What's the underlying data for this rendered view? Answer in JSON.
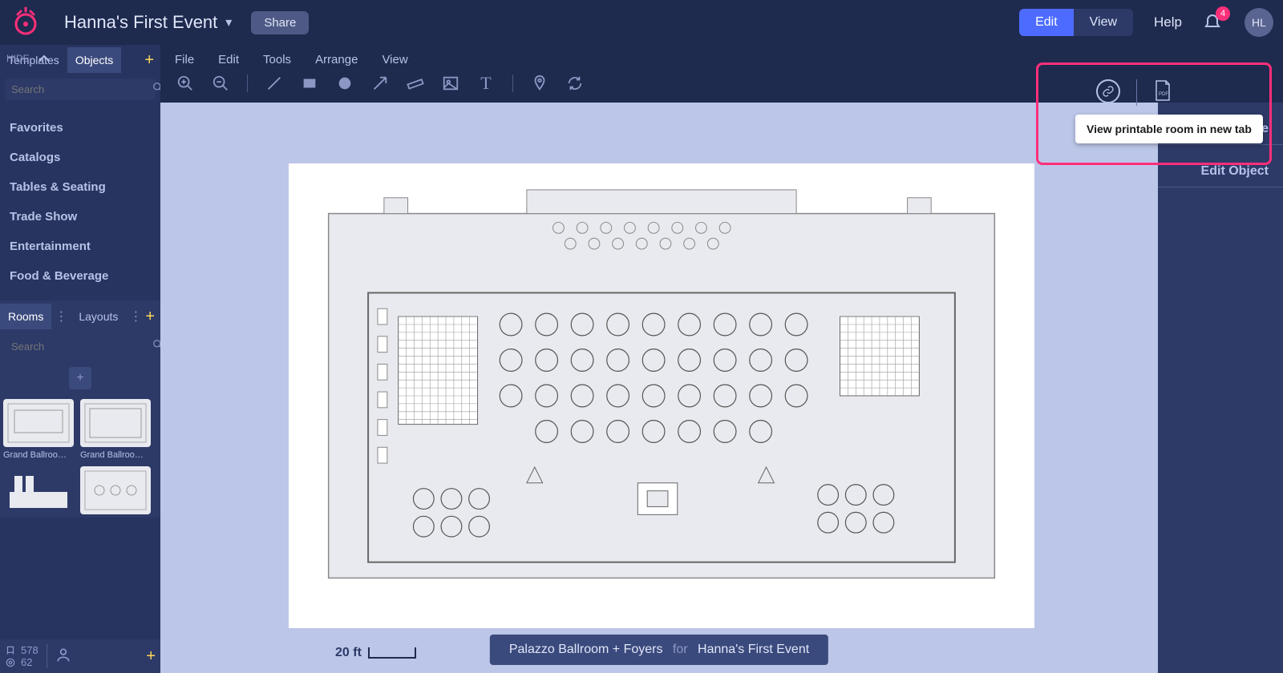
{
  "header": {
    "event_name": "Hanna's First Event",
    "share_label": "Share",
    "mode_edit": "Edit",
    "mode_view": "View",
    "help_label": "Help",
    "notif_count": "4",
    "avatar_initials": "HL"
  },
  "hide_label": "HIDE",
  "menubar": {
    "file": "File",
    "edit": "Edit",
    "tools": "Tools",
    "arrange": "Arrange",
    "view": "View"
  },
  "sidebar": {
    "tab_templates": "Templates",
    "tab_objects": "Objects",
    "search_placeholder": "Search",
    "categories": {
      "favorites": "Favorites",
      "catalogs": "Catalogs",
      "tables": "Tables & Seating",
      "tradeshow": "Trade Show",
      "entertainment": "Entertainment",
      "food": "Food & Beverage"
    }
  },
  "subpanel": {
    "tab_rooms": "Rooms",
    "tab_layouts": "Layouts",
    "search_placeholder": "Search",
    "thumbs": {
      "t1": "Grand Ballroom…",
      "t2": "Grand Ballroom…"
    }
  },
  "stats": {
    "count_a": "578",
    "count_b": "62"
  },
  "rightpanel": {
    "edit_object": "Edit Object",
    "note_placeholder": "te"
  },
  "callout": {
    "tooltip": "View printable room in new tab"
  },
  "scale": {
    "label": "20 ft"
  },
  "crumbs": {
    "room": "Palazzo Ballroom + Foyers",
    "for": "for",
    "event": "Hanna's First Event"
  }
}
